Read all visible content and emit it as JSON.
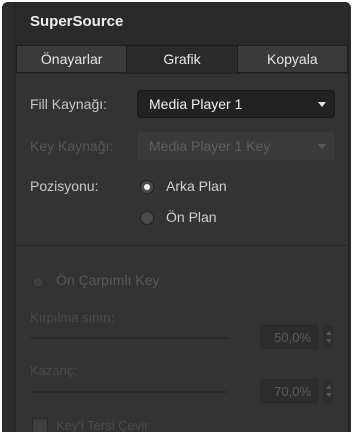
{
  "panel": {
    "title": "SuperSource"
  },
  "tabs": [
    {
      "label": "Önayarlar",
      "active": false
    },
    {
      "label": "Grafik",
      "active": true
    },
    {
      "label": "Kopyala",
      "active": false
    }
  ],
  "fill": {
    "label": "Fill Kaynağı:",
    "value": "Media Player 1"
  },
  "key": {
    "label": "Key Kaynağı:",
    "value": "Media Player 1 Key"
  },
  "position": {
    "label": "Pozisyonu:",
    "options": [
      {
        "label": "Arka Plan",
        "selected": true
      },
      {
        "label": "Ön Plan",
        "selected": false
      }
    ]
  },
  "premultiplied": {
    "label": "Ön Çarpımlı Key"
  },
  "clip": {
    "label": "Kırpılma sınırı:",
    "value": "50,0%"
  },
  "gain": {
    "label": "Kazanç:",
    "value": "70,0%"
  },
  "invert": {
    "label": "Key'i Tersi Çevir"
  }
}
